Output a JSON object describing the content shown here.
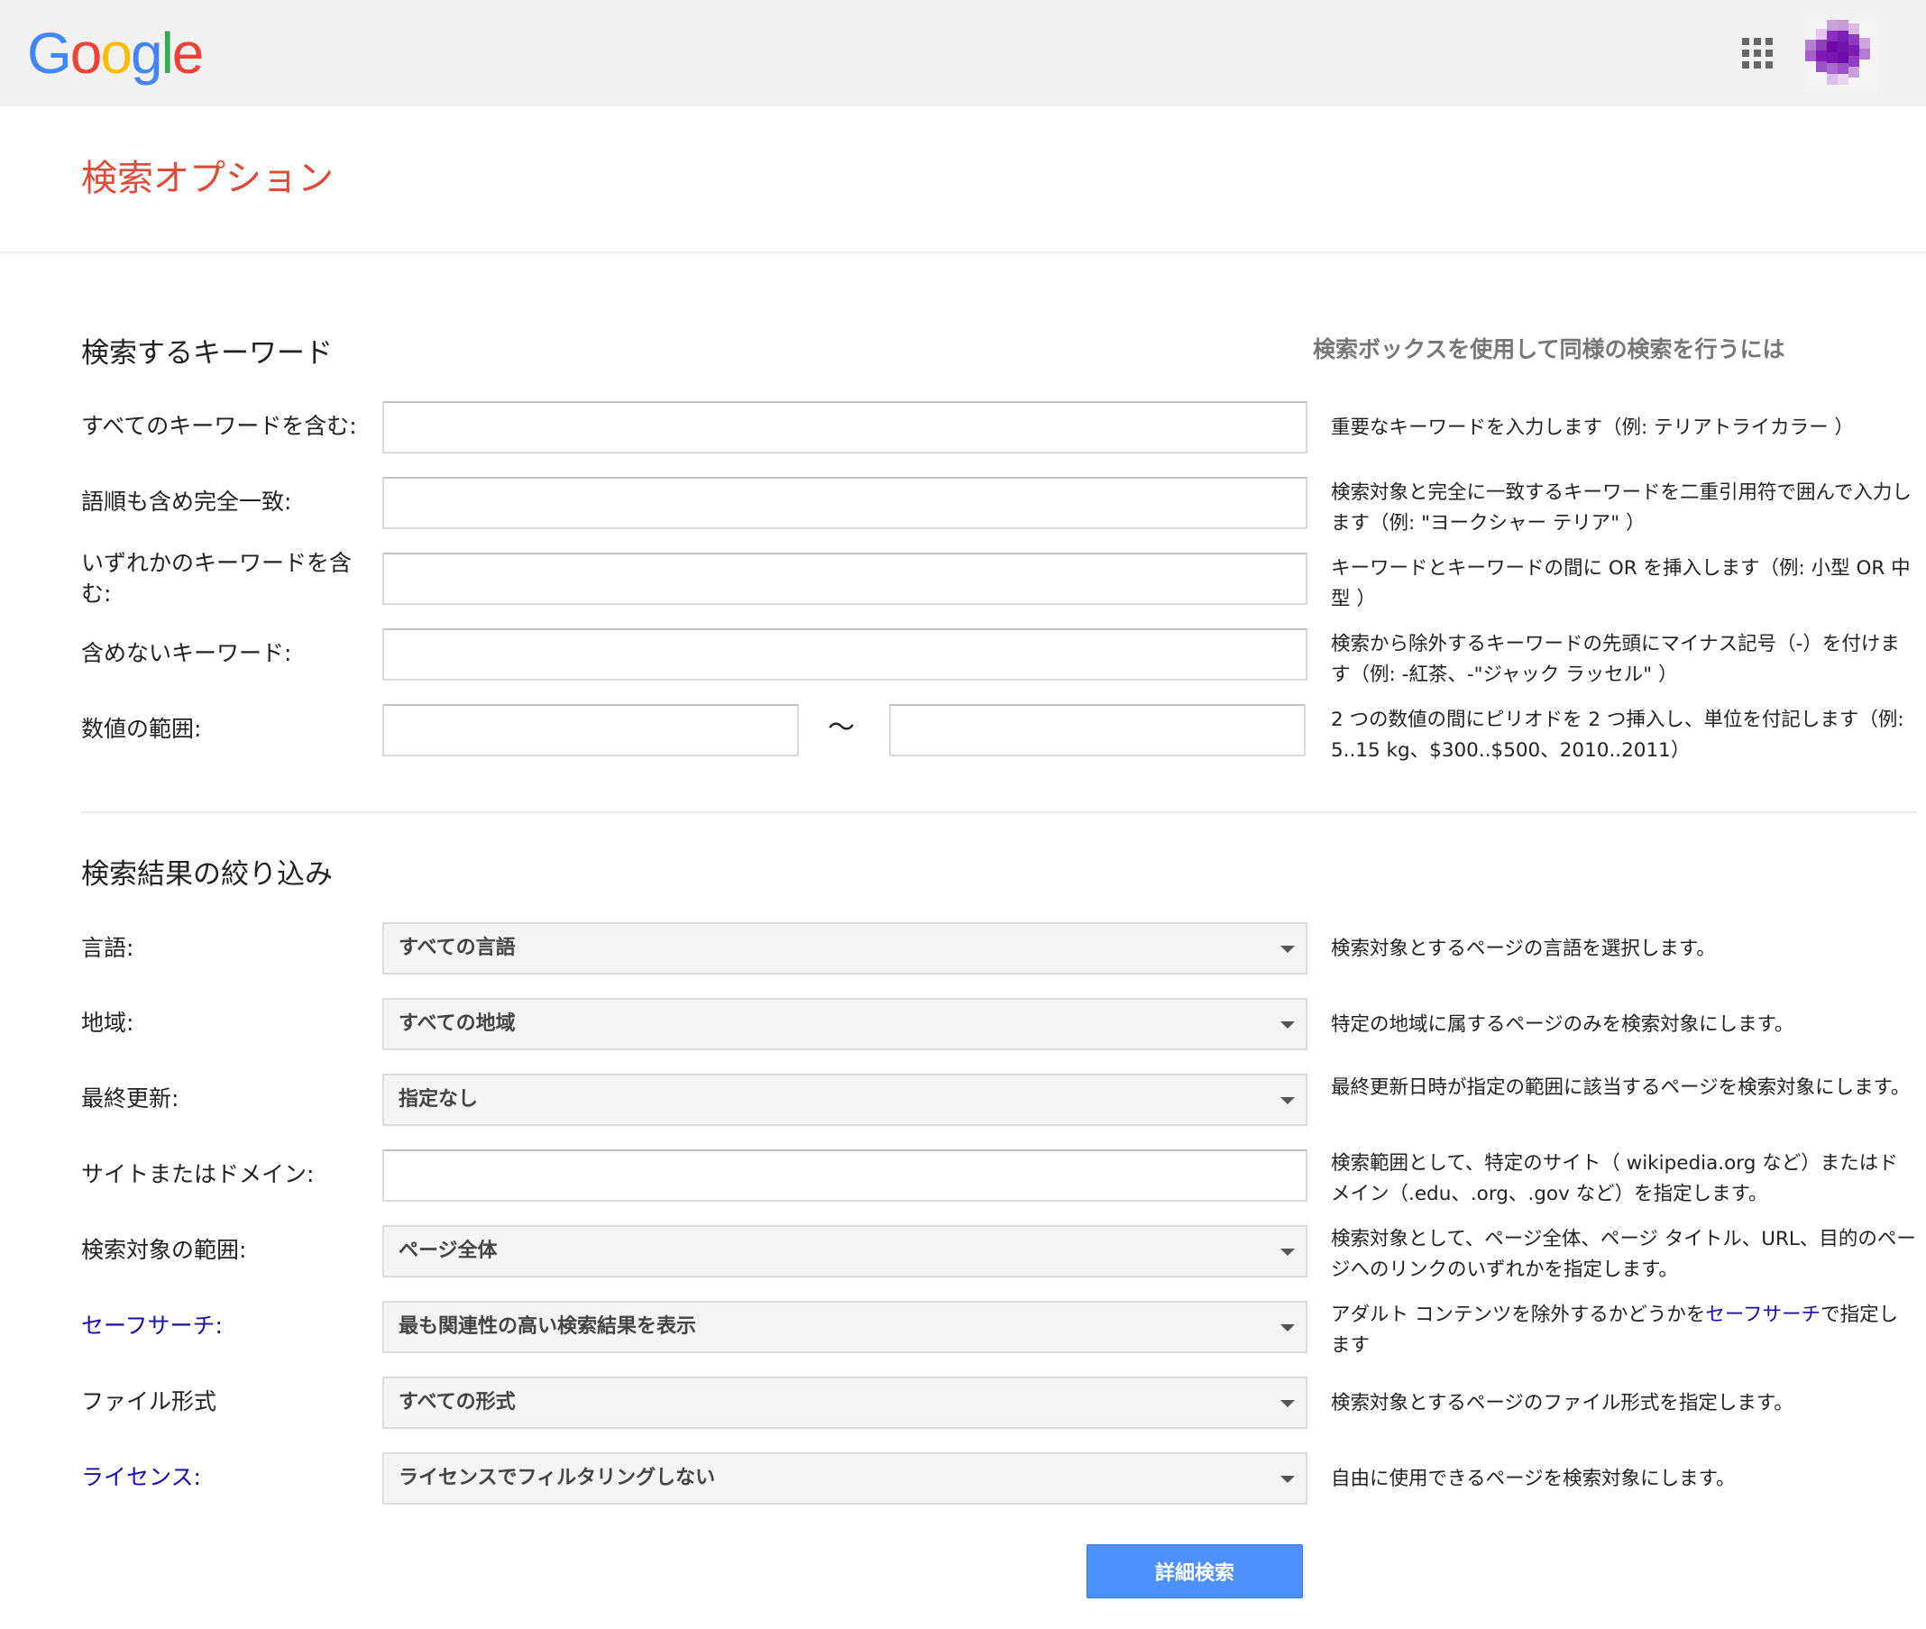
{
  "header": {
    "logo_letters": [
      {
        "ch": "G",
        "color": "#4285F4"
      },
      {
        "ch": "o",
        "color": "#EA4335"
      },
      {
        "ch": "o",
        "color": "#FBBC05"
      },
      {
        "ch": "g",
        "color": "#4285F4"
      },
      {
        "ch": "l",
        "color": "#34A853"
      },
      {
        "ch": "e",
        "color": "#EA4335"
      }
    ],
    "apps_icon": "apps-grid-icon",
    "avatar_icon": "account-avatar"
  },
  "page_title": "検索オプション",
  "keywords": {
    "section_title": "検索するキーワード",
    "help_header": "検索ボックスを使用して同様の検索を行うには",
    "rows": [
      {
        "label": "すべてのキーワードを含む:",
        "value": "",
        "help": "重要なキーワードを入力します（例: テリアトライカラー ）"
      },
      {
        "label": "語順も含め完全一致:",
        "value": "",
        "help": "検索対象と完全に一致するキーワードを二重引用符で囲んで入力します（例: \"ヨークシャー テリア\" ）"
      },
      {
        "label": "いずれかのキーワードを含む:",
        "value": "",
        "help": "キーワードとキーワードの間に OR を挿入します（例: 小型 OR 中型 ）"
      },
      {
        "label": "含めないキーワード:",
        "value": "",
        "help": "検索から除外するキーワードの先頭にマイナス記号（-）を付けます（例: -紅茶、-\"ジャック ラッセル\" ）"
      }
    ],
    "range": {
      "label": "数値の範囲:",
      "from": "",
      "to": "",
      "separator": "～",
      "help": "2 つの数値の間にピリオドを 2 つ挿入し、単位を付記します（例: 5..15 kg、$300..$500、2010..2011）"
    }
  },
  "narrow": {
    "section_title": "検索結果の絞り込み",
    "language": {
      "label": "言語:",
      "value": "すべての言語",
      "help": "検索対象とするページの言語を選択します。"
    },
    "region": {
      "label": "地域:",
      "value": "すべての地域",
      "help": "特定の地域に属するページのみを検索対象にします。"
    },
    "last_update": {
      "label": "最終更新:",
      "value": "指定なし",
      "help": "最終更新日時が指定の範囲に該当するページを検索対象にします。"
    },
    "site": {
      "label": "サイトまたはドメイン:",
      "value": "",
      "help": "検索範囲として、特定のサイト（ wikipedia.org など）またはドメイン（.edu、.org、.gov など）を指定します。"
    },
    "terms_appearing": {
      "label": "検索対象の範囲:",
      "value": "ページ全体",
      "help": "検索対象として、ページ全体、ページ タイトル、URL、目的のページへのリンクのいずれかを指定します。"
    },
    "safesearch": {
      "label": "セーフサーチ:",
      "value": "最も関連性の高い検索結果を表示",
      "help_before": "アダルト コンテンツを除外するかどうかを",
      "help_link": "セーフサーチ",
      "help_after": "で指定します"
    },
    "file_type": {
      "label": "ファイル形式",
      "value": "すべての形式",
      "help": "検索対象とするページのファイル形式を指定します。"
    },
    "usage_rights": {
      "label": "ライセンス:",
      "value": "ライセンスでフィルタリングしない",
      "help": "自由に使用できるページを検索対象にします。"
    }
  },
  "submit_label": "詳細検索",
  "colors": {
    "page_title": "#dd4b39",
    "link": "#1a0dab",
    "submit_bg": "#4d90fe",
    "topbar_bg": "#f1f1f1"
  }
}
